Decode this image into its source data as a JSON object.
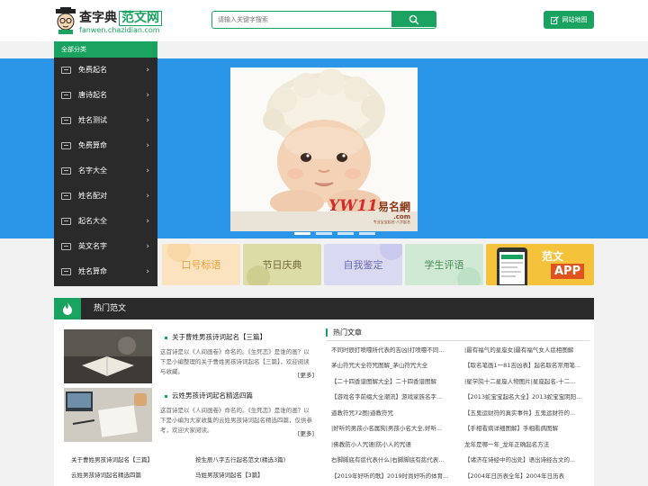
{
  "header": {
    "brand_main": "查字典",
    "brand_highlight": "范文网",
    "brand_url": "fanwen.chazidian.com",
    "search_placeholder": "请输入关键字搜索",
    "sitemap_label": "网站地图"
  },
  "sidebar": {
    "title": "全部分类",
    "items": [
      {
        "label": "免费起名"
      },
      {
        "label": "唐诗起名"
      },
      {
        "label": "姓名测试"
      },
      {
        "label": "免费算命"
      },
      {
        "label": "名字大全"
      },
      {
        "label": "姓名配对"
      },
      {
        "label": "起名大全"
      },
      {
        "label": "英文名字"
      },
      {
        "label": "姓名算命"
      }
    ]
  },
  "banner": {
    "watermark_main": "YW11",
    "watermark_cn": "易名網",
    "watermark_com": ".com",
    "watermark_sub": "专业宝宝起名·八字起名"
  },
  "cards": [
    {
      "label": "口号标语",
      "color": "#e8a13c",
      "bg": "#fbe3bf"
    },
    {
      "label": "节日庆典",
      "color": "#6f6a3a",
      "bg": "#d9d9a2"
    },
    {
      "label": "自我鉴定",
      "color": "#6a6bb0",
      "bg": "#d6d6f0"
    },
    {
      "label": "学生评语",
      "color": "#4a8c57",
      "bg": "#cde8d3"
    },
    {
      "label": "范文",
      "sub": "APP",
      "color": "#ffffff",
      "bg": "#f5c23c"
    }
  ],
  "hot": {
    "title": "热门范文",
    "posts": [
      {
        "title": "关于曹姓男孩诗词起名【三篇】",
        "desc": "这首诗是以《人间画卷》命名的。《生死恋》是谁的画？以下是小编整理的关于曹姓男孩诗词起名【三篇】，欢迎阅读与收藏。",
        "more": "[更多]"
      },
      {
        "title": "云姓男孩诗词起名精选四篇",
        "desc": "这首诗是以《人间画卷》命名的。《生死恋》是谁的画？以下是小编为大家收集的云姓男孩诗词起名精选四篇，仅供参考，欢迎大家阅读。",
        "more": "[更多]"
      }
    ],
    "links": [
      {
        "text": "关于曹姓男孩诗词起名【三篇】"
      },
      {
        "text": "按生辰八字五行起名范文(精选3篇)"
      },
      {
        "text": "云姓男孩诗词起名精选四篇"
      },
      {
        "text": "马姓男孩诗词起名【3篇】"
      }
    ],
    "articles_title": "热门文章",
    "articles": [
      {
        "text": "不同时辰打喷嚏所代表的吉凶|打喷嚏不同..."
      },
      {
        "text": "|最有福气的星座女|最有福气女人痣相图解"
      },
      {
        "text": "茅山符咒大全符咒图解_茅山符咒大全"
      },
      {
        "text": "【取名笔画1一81吉凶表】起名取名常用笔..."
      },
      {
        "text": "【二十四香谱图解大全】二十四香谱图解"
      },
      {
        "text": "|星学院十二星座人物图片|星座起名-十二..."
      },
      {
        "text": "【游戏名字前缀大全潮流】游戏家族名字..."
      },
      {
        "text": "【2013蛇宝宝起名大全】2013蛇宝宝阴阳..."
      },
      {
        "text": "道教符咒72图|道教符咒"
      },
      {
        "text": "【五鬼运财符的真实事件】五鬼运财符的..."
      },
      {
        "text": "|好听的男孩小名属狗|男孩小名大全,好听..."
      },
      {
        "text": "【手相看病详细图解】手相看病图解"
      },
      {
        "text": "|佛教防小人咒语|防小人的咒语"
      },
      {
        "text": "龙年是哪一年_龙年正确起名方法"
      },
      {
        "text": "右脚脚底有痣代表什么|右脚脚底有痣代表..."
      },
      {
        "text": "【诸济在诗经中的出处】语出诗经古文的..."
      },
      {
        "text": "【2019年好听的歌】2019时尚好听的体育..."
      },
      {
        "text": "【2004年日历表全年】2004年日历表"
      }
    ]
  },
  "colors": {
    "accent": "#1aa260",
    "banner": "#2b95e8",
    "dark": "#2a2a2a"
  }
}
